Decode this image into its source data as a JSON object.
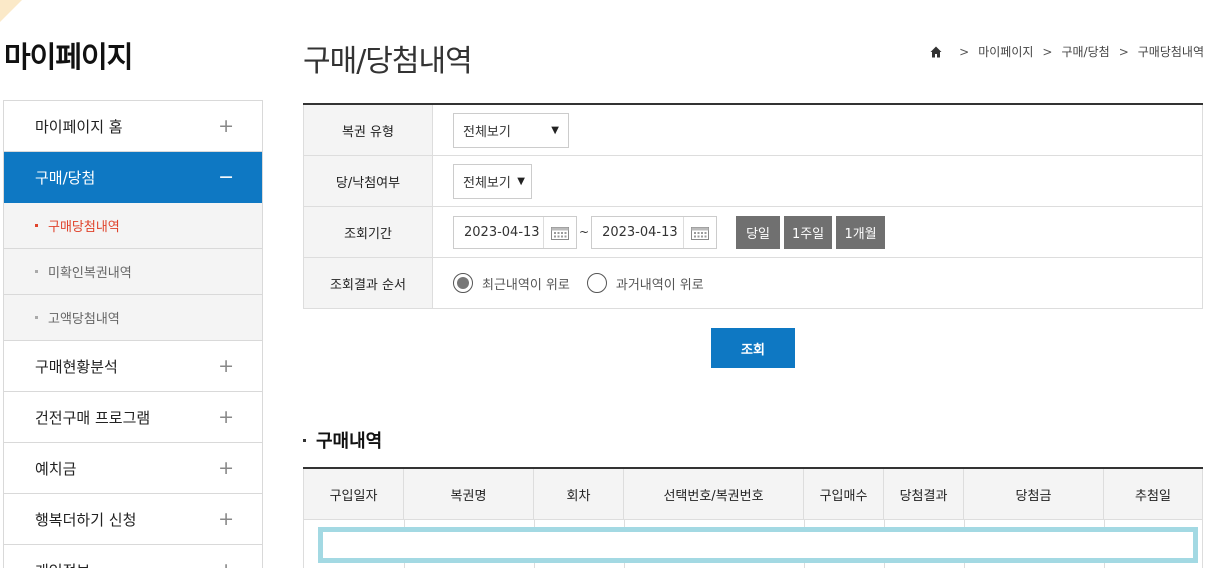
{
  "sidebar": {
    "title": "마이페이지",
    "items": [
      {
        "label": "마이페이지 홈",
        "sign": "+"
      },
      {
        "label": "구매/당첨",
        "sign": "−"
      },
      {
        "label": "구매현황분석",
        "sign": "+"
      },
      {
        "label": "건전구매 프로그램",
        "sign": "+"
      },
      {
        "label": "예치금",
        "sign": "+"
      },
      {
        "label": "행복더하기 신청",
        "sign": "+"
      },
      {
        "label": "개인정보",
        "sign": "+"
      }
    ],
    "sub_items": [
      {
        "label": "구매당첨내역"
      },
      {
        "label": "미확인복권내역"
      },
      {
        "label": "고액당첨내역"
      }
    ]
  },
  "header": {
    "title": "구매/당첨내역",
    "breadcrumb": [
      "마이페이지",
      "구매/당첨",
      "구매당첨내역"
    ]
  },
  "search": {
    "lottery_type_label": "복권 유형",
    "lottery_type_value": "전체보기",
    "win_status_label": "당/낙첨여부",
    "win_status_value": "전체보기",
    "period_label": "조회기간",
    "start_date": "2023-04-13",
    "tilde": "~",
    "end_date": "2023-04-13",
    "period_buttons": [
      "당일",
      "1주일",
      "1개월"
    ],
    "order_label": "조회결과 순서",
    "order_options": [
      "최근내역이 위로",
      "과거내역이 위로"
    ],
    "order_selected": 0,
    "submit_label": "조회"
  },
  "purchases": {
    "title": "구매내역",
    "columns": [
      "구입일자",
      "복권명",
      "회차",
      "선택번호/복권번호",
      "구입매수",
      "당첨결과",
      "당첨금",
      "추첨일"
    ]
  },
  "colors": {
    "accent": "#0e78c3",
    "active_sub": "#e0432c",
    "gray_button": "#707070",
    "highlight": "#a3d9e3"
  }
}
